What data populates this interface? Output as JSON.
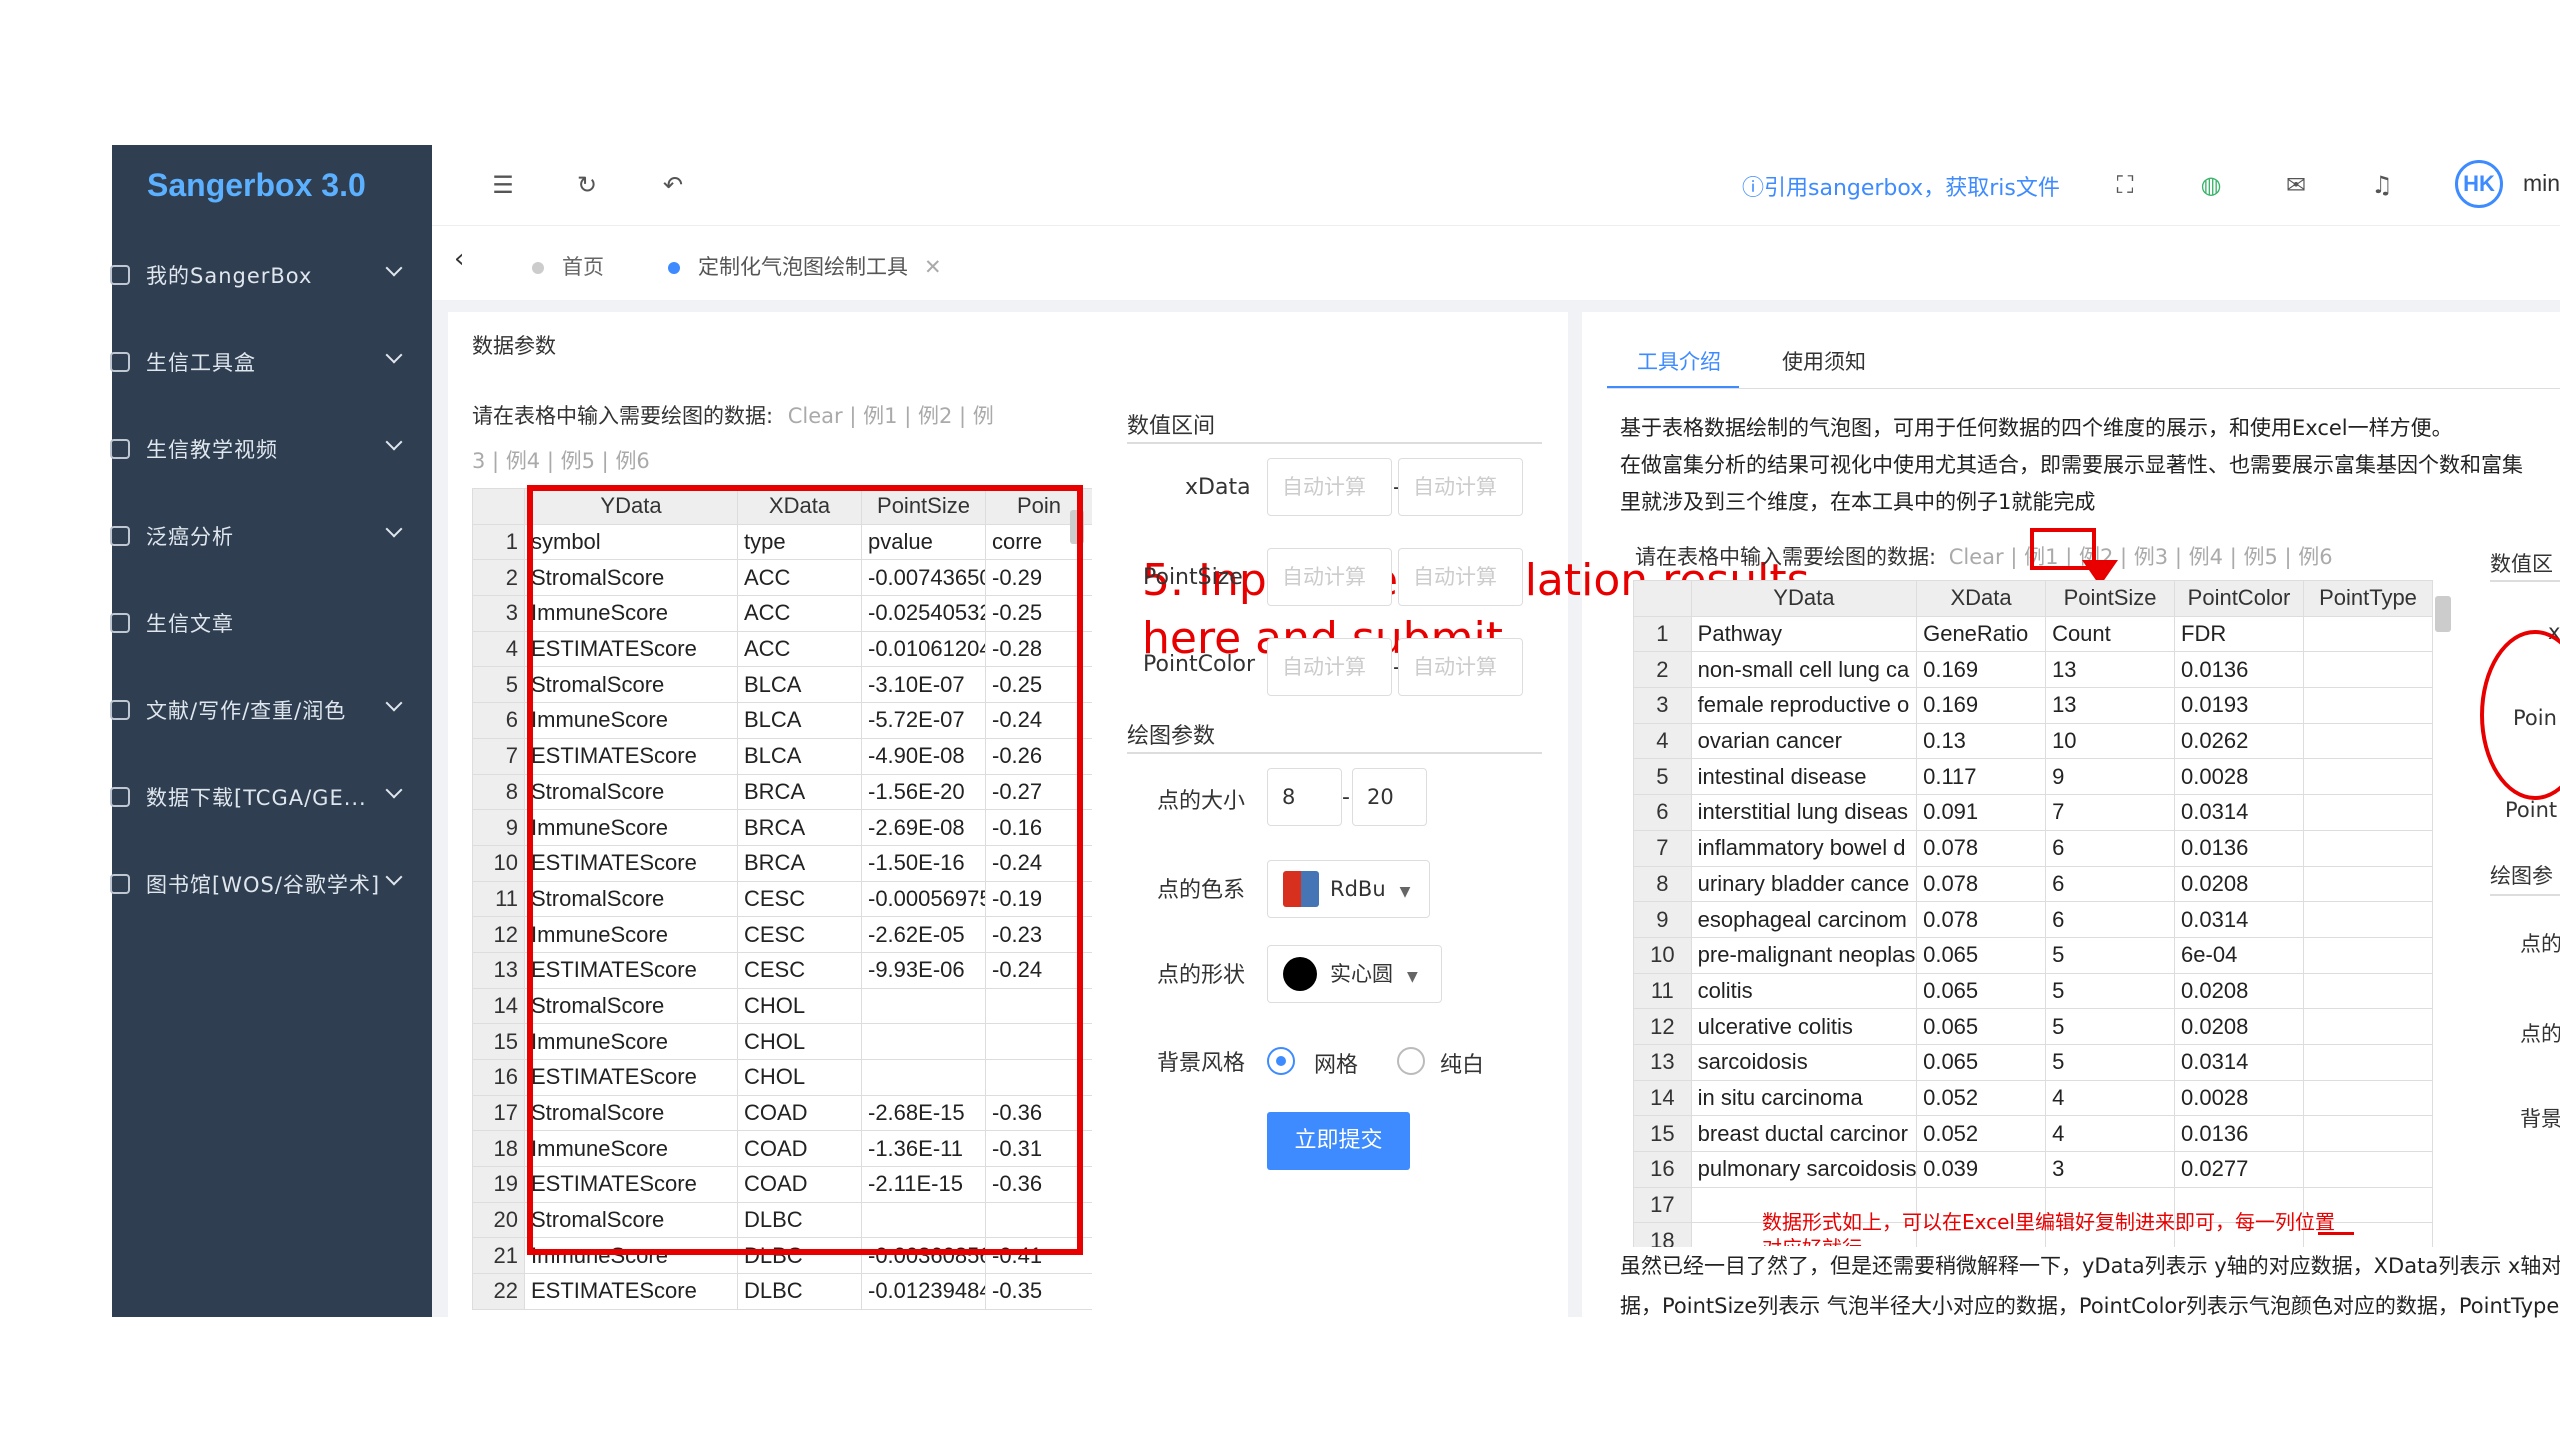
{
  "app": {
    "title": "Sangerbox 3.0",
    "cite": "ⓘ引用sangerbox，获取ris文件",
    "user": "min",
    "avatar": "HK"
  },
  "sidebar": {
    "items": [
      {
        "label": "我的SangerBox",
        "icon": "user-icon"
      },
      {
        "label": "生信工具盒",
        "icon": "toolbox-icon"
      },
      {
        "label": "生信教学视频",
        "icon": "video-icon"
      },
      {
        "label": "泛癌分析",
        "icon": "shield-icon"
      },
      {
        "label": "生信文章",
        "icon": "book-icon"
      },
      {
        "label": "文献/写作/查重/润色",
        "icon": "gear-icon"
      },
      {
        "label": "数据下载[TCGA/GE...",
        "icon": "database-icon"
      },
      {
        "label": "图书馆[WOS/谷歌学术]",
        "icon": "library-icon"
      }
    ]
  },
  "tabs": [
    {
      "label": "首页"
    },
    {
      "label": "定制化气泡图绘制工具"
    }
  ],
  "left_panel": {
    "title": "数据参数",
    "prompt": "请在表格中输入需要绘图的数据:",
    "links": [
      "Clear",
      "例1",
      "例2",
      "例",
      "3",
      "例4",
      "例5",
      "例6"
    ],
    "headers": [
      "YData",
      "XData",
      "PointSize",
      "Poin"
    ],
    "rows": [
      [
        "symbol",
        "type",
        "pvalue",
        "corre"
      ],
      [
        "StromalScore",
        "ACC",
        "-0.00743650",
        "-0.29"
      ],
      [
        "ImmuneScore",
        "ACC",
        "-0.02540532",
        "-0.25"
      ],
      [
        "ESTIMATEScore",
        "ACC",
        "-0.01061204",
        "-0.28"
      ],
      [
        "StromalScore",
        "BLCA",
        "-3.10E-07",
        "-0.25"
      ],
      [
        "ImmuneScore",
        "BLCA",
        "-5.72E-07",
        "-0.24"
      ],
      [
        "ESTIMATEScore",
        "BLCA",
        "-4.90E-08",
        "-0.26"
      ],
      [
        "StromalScore",
        "BRCA",
        "-1.56E-20",
        "-0.27"
      ],
      [
        "ImmuneScore",
        "BRCA",
        "-2.69E-08",
        "-0.16"
      ],
      [
        "ESTIMATEScore",
        "BRCA",
        "-1.50E-16",
        "-0.24"
      ],
      [
        "StromalScore",
        "CESC",
        "-0.00056975",
        "-0.19"
      ],
      [
        "ImmuneScore",
        "CESC",
        "-2.62E-05",
        "-0.23"
      ],
      [
        "ESTIMATEScore",
        "CESC",
        "-9.93E-06",
        "-0.24"
      ],
      [
        "StromalScore",
        "CHOL",
        "",
        ""
      ],
      [
        "ImmuneScore",
        "CHOL",
        "",
        ""
      ],
      [
        "ESTIMATEScore",
        "CHOL",
        "",
        ""
      ],
      [
        "StromalScore",
        "COAD",
        "-2.68E-15",
        "-0.36"
      ],
      [
        "ImmuneScore",
        "COAD",
        "-1.36E-11",
        "-0.31"
      ],
      [
        "ESTIMATEScore",
        "COAD",
        "-2.11E-15",
        "-0.36"
      ],
      [
        "StromalScore",
        "DLBC",
        "",
        ""
      ],
      [
        "ImmuneScore",
        "DLBC",
        "-0.00360856",
        "-0.41"
      ],
      [
        "ESTIMATEScore",
        "DLBC",
        "-0.01239484",
        "-0.35"
      ]
    ]
  },
  "form": {
    "range_title": "数值区间",
    "xdata_label": "xData",
    "pointsize_label": "PointSize",
    "pointcolor_label": "PointColor",
    "auto": "自动计算",
    "params_title": "绘图参数",
    "size_label": "点的大小",
    "size_min": "8",
    "size_max": "20",
    "color_label": "点的色系",
    "color_value": "RdBu",
    "shape_label": "点的形状",
    "shape_value": "实心圆",
    "bg_label": "背景风格",
    "bg_grid": "网格",
    "bg_white": "纯白",
    "submit": "立即提交",
    "dash": "-"
  },
  "annotation": {
    "line1": "5. Input the correlation results",
    "line2": "here and submit"
  },
  "right_panel": {
    "tabs": [
      "工具介绍",
      "使用须知"
    ],
    "intro1": "基于表格数据绘制的气泡图，可用于任何数据的四个维度的展示，和使用Excel一样方便。",
    "intro2": "在做富集分析的结果可视化中使用尤其适合，即需要展示显著性、也需要展示富集基因个数和富集",
    "intro3": "里就涉及到三个维度，在本工具中的例子1就能完成",
    "prompt": "请在表格中输入需要绘图的数据:",
    "links": [
      "Clear",
      "例1",
      "例2",
      "例3",
      "例4",
      "例5",
      "例6"
    ],
    "side_title": "数值区",
    "side_params": "绘图参",
    "side_point": "Poin",
    "side_point2": "Point",
    "side_x": "x",
    "side_lbl1": "点的",
    "side_lbl2": "点的",
    "side_lbl3": "背景",
    "headers": [
      "YData",
      "XData",
      "PointSize",
      "PointColor",
      "PointType"
    ],
    "rows": [
      [
        "Pathway",
        "GeneRatio",
        "Count",
        "FDR",
        ""
      ],
      [
        "non-small cell lung ca",
        "0.169",
        "13",
        "0.0136",
        ""
      ],
      [
        "female reproductive o",
        "0.169",
        "13",
        "0.0193",
        ""
      ],
      [
        "ovarian cancer",
        "0.13",
        "10",
        "0.0262",
        ""
      ],
      [
        "intestinal disease",
        "0.117",
        "9",
        "0.0028",
        ""
      ],
      [
        "interstitial lung diseas",
        "0.091",
        "7",
        "0.0314",
        ""
      ],
      [
        "inflammatory bowel d",
        "0.078",
        "6",
        "0.0136",
        ""
      ],
      [
        "urinary bladder cance",
        "0.078",
        "6",
        "0.0208",
        ""
      ],
      [
        "esophageal carcinom",
        "0.078",
        "6",
        "0.0314",
        ""
      ],
      [
        "pre-malignant neoplas",
        "0.065",
        "5",
        "6e-04",
        ""
      ],
      [
        "colitis",
        "0.065",
        "5",
        "0.0208",
        ""
      ],
      [
        "ulcerative colitis",
        "0.065",
        "5",
        "0.0208",
        ""
      ],
      [
        "sarcoidosis",
        "0.065",
        "5",
        "0.0314",
        ""
      ],
      [
        "in situ carcinoma",
        "0.052",
        "4",
        "0.0028",
        ""
      ],
      [
        "breast ductal carcinor",
        "0.052",
        "4",
        "0.0136",
        ""
      ],
      [
        "pulmonary sarcoidosis",
        "0.039",
        "3",
        "0.0277",
        ""
      ],
      [
        "",
        "",
        "",
        "",
        ""
      ],
      [
        "",
        "",
        "",
        "",
        ""
      ]
    ],
    "note": "数据形式如上，可以在Excel里编辑好复制进来即可，每一列位置",
    "note2": "对应好就行",
    "para1": "虽然已经一目了然了，但是还需要稍微解释一下，yData列表示 y轴的对应数据，XData列表示 x轴对",
    "para2": "据，PointSize列表示 气泡半径大小对应的数据，PointColor列表示气泡颜色对应的数据，PointType"
  }
}
